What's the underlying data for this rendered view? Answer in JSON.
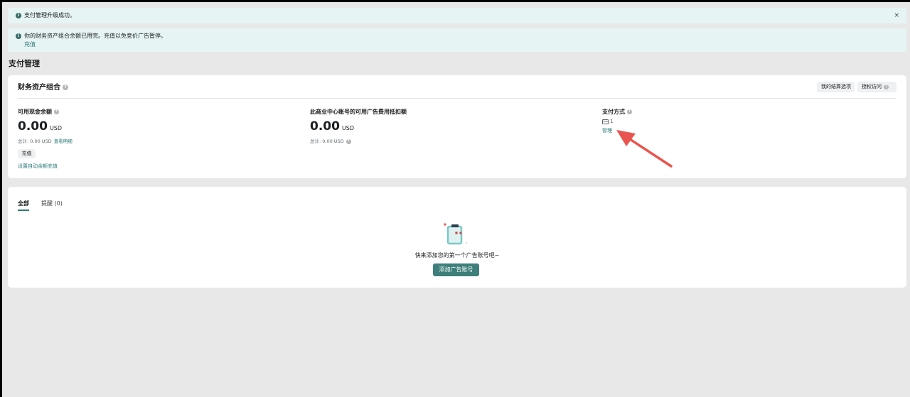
{
  "banners": {
    "upgrade": {
      "message": "支付管理升级成功。",
      "close": "×"
    },
    "balance": {
      "message": "你的财务资产组合余额已用完。充值以免竞价广告暂停。",
      "link": "充值"
    }
  },
  "page_title": "支付管理",
  "portfolio_card": {
    "title": "财务资产组合",
    "buttons": {
      "settlement": "我的结算选项",
      "auth_access": "授权访问"
    },
    "cash": {
      "label": "可用现金余额",
      "amount": "0.00",
      "currency": "USD",
      "total": "总计: 0.00 USD",
      "view_details": "查看明细",
      "recharge": "充值",
      "auto_recharge": "设置自动余额充值"
    },
    "credit": {
      "label": "此商业中心账号的可用广告费用抵扣额",
      "amount": "0.00",
      "currency": "USD",
      "total": "总计: 0.00 USD"
    },
    "payment": {
      "label": "支付方式",
      "card_count": "1",
      "manage": "管理"
    }
  },
  "accounts_card": {
    "tabs": {
      "all": "全部",
      "reminder": "提醒 (0)"
    },
    "empty_message": "快来添加您的第一个广告账号吧~",
    "add_button": "添加广告账号"
  },
  "colors": {
    "accent": "#2b7a78",
    "primary_button": "#3e7f7b",
    "banner_bg": "#e6f4f3",
    "arrow": "#e8554e"
  },
  "icons": [
    "info-icon",
    "close-icon",
    "help-icon",
    "credit-card-icon",
    "red-arrow-annotation",
    "clipboard-illustration"
  ]
}
